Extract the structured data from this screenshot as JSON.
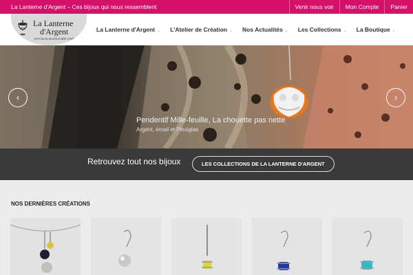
{
  "topbar": {
    "tagline": "La Lanterne d'Argent – Ces bijoux qui nous ressemblent",
    "links": [
      "Venir nous voir",
      "Mon Compte",
      "Panier"
    ]
  },
  "logo": {
    "line1": "La Lanterne",
    "line2": "d'Argent",
    "line3": "ARTISAN BIJOUTIER CRÉATEUR"
  },
  "nav": {
    "items": [
      "La Lanterne d'Argent",
      "L'Atelier de Création",
      "Nos Actualités",
      "Les Collections",
      "La Boutique"
    ]
  },
  "hero": {
    "title": "Pendentif Mille-feuille, La chouette pas nette",
    "subtitle": "Argent, émail et Plexiglas",
    "prev_icon": "‹",
    "next_icon": "›"
  },
  "cta": {
    "text": "Retrouvez tout nos bijoux",
    "button": "LES COLLECTIONS DE LA LANTERNE D'ARGENT"
  },
  "section": {
    "title": "NOS DERNIÈRES CRÉATIONS"
  },
  "colors": {
    "brand": "#d4106a",
    "band": "#3a3a3a"
  }
}
